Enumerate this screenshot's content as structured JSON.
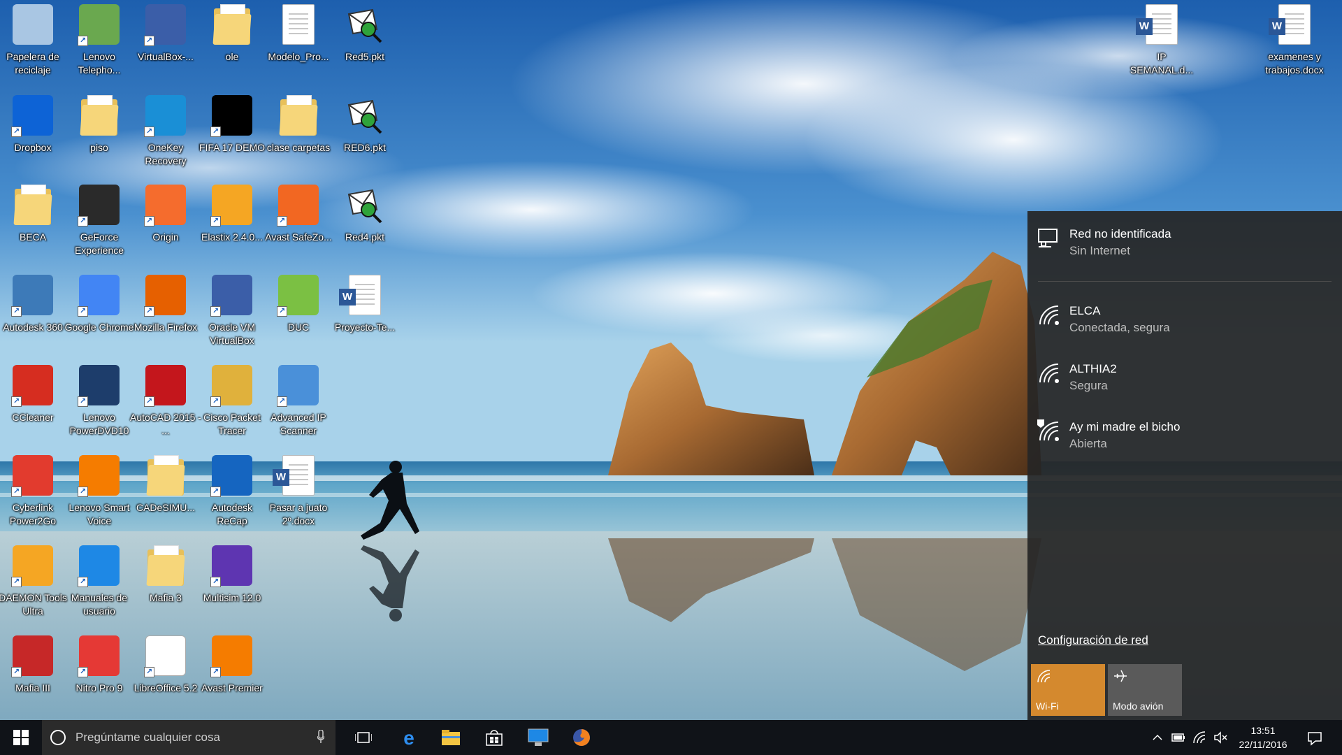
{
  "desktop": {
    "icons": [
      {
        "label": "Papelera de reciclaje",
        "icon": "recycle-bin-icon",
        "color": "#a9c6e3"
      },
      {
        "label": "Lenovo Telepho...",
        "icon": "lenovo-telephony-icon",
        "color": "#6aa84f"
      },
      {
        "label": "VirtualBox-...",
        "icon": "virtualbox-icon",
        "color": "#3b5ea8"
      },
      {
        "label": "ole",
        "icon": "folder-icon",
        "color": "#f6d67a"
      },
      {
        "label": "Modelo_Pro...",
        "icon": "document-icon",
        "color": "#ffffff"
      },
      {
        "label": "Red5.pkt",
        "icon": "packet-tracer-file-icon",
        "color": "#2fa33a"
      },
      {
        "label": "Dropbox",
        "icon": "dropbox-icon",
        "color": "#0d63d6"
      },
      {
        "label": "piso",
        "icon": "folder-icon",
        "color": "#f6d67a"
      },
      {
        "label": "OneKey Recovery",
        "icon": "onekey-recovery-icon",
        "color": "#1a8fd6"
      },
      {
        "label": "FIFA 17 DEMO",
        "icon": "fifa17-icon",
        "color": "#000000"
      },
      {
        "label": "clase carpetas",
        "icon": "folder-icon",
        "color": "#f6d67a"
      },
      {
        "label": "RED6.pkt",
        "icon": "packet-tracer-file-icon",
        "color": "#2fa33a"
      },
      {
        "label": "BECA",
        "icon": "folder-icon",
        "color": "#f6d67a"
      },
      {
        "label": "GeForce Experience",
        "icon": "geforce-icon",
        "color": "#2a2a2a"
      },
      {
        "label": "Origin",
        "icon": "origin-icon",
        "color": "#f56c2d"
      },
      {
        "label": "Elastix 2.4.0...",
        "icon": "elastix-icon",
        "color": "#f5a623"
      },
      {
        "label": "Avast SafeZo...",
        "icon": "avast-safezone-icon",
        "color": "#f26722"
      },
      {
        "label": "Red4.pkt",
        "icon": "packet-tracer-file-icon",
        "color": "#2fa33a"
      },
      {
        "label": "Autodesk 360",
        "icon": "autodesk360-icon",
        "color": "#3d7ab8"
      },
      {
        "label": "Google Chrome",
        "icon": "chrome-icon",
        "color": "#4285f4"
      },
      {
        "label": "Mozilla Firefox",
        "icon": "firefox-icon",
        "color": "#e66000"
      },
      {
        "label": "Oracle VM VirtualBox",
        "icon": "virtualbox-icon",
        "color": "#3b5ea8"
      },
      {
        "label": "DUC",
        "icon": "duc-icon",
        "color": "#7bc043"
      },
      {
        "label": "Proyecto-Te...",
        "icon": "word-document-icon",
        "color": "#2b5797"
      },
      {
        "label": "CCleaner",
        "icon": "ccleaner-icon",
        "color": "#d62d20"
      },
      {
        "label": "Lenovo PowerDVD10",
        "icon": "powerdvd-icon",
        "color": "#1d3d6b"
      },
      {
        "label": "AutoCAD 2015 - ...",
        "icon": "autocad-icon",
        "color": "#c4161c"
      },
      {
        "label": "Cisco Packet Tracer",
        "icon": "cisco-packet-tracer-icon",
        "color": "#e0b13c"
      },
      {
        "label": "Advanced IP Scanner",
        "icon": "advanced-ip-scanner-icon",
        "color": "#4a90d9"
      },
      {
        "label": "Cyberlink Power2Go",
        "icon": "power2go-icon",
        "color": "#e23b2e"
      },
      {
        "label": "Lenovo Smart Voice",
        "icon": "smart-voice-icon",
        "color": "#f57c00"
      },
      {
        "label": "CADeSIMU...",
        "icon": "folder-icon",
        "color": "#f6d67a"
      },
      {
        "label": "Autodesk ReCap",
        "icon": "autodesk-recap-icon",
        "color": "#1565c0"
      },
      {
        "label": "Pasar a juato 2º.docx",
        "icon": "word-document-icon",
        "color": "#2b5797"
      },
      {
        "label": "DAEMON Tools Ultra",
        "icon": "daemon-tools-icon",
        "color": "#f5a623"
      },
      {
        "label": "Manuales de usuario",
        "icon": "lenovo-manuals-icon",
        "color": "#1e88e5"
      },
      {
        "label": "Mafia 3",
        "icon": "folder-icon",
        "color": "#f6d67a"
      },
      {
        "label": "Multisim 12.0",
        "icon": "multisim-icon",
        "color": "#5e35b1"
      },
      {
        "label": "Mafia III",
        "icon": "mafia3-icon",
        "color": "#c62828"
      },
      {
        "label": "Nitro Pro 9",
        "icon": "nitro-pro-icon",
        "color": "#e53935"
      },
      {
        "label": "LibreOffice 5.2",
        "icon": "libreoffice-icon",
        "color": "#ffffff"
      },
      {
        "label": "Avast Premier",
        "icon": "avast-premier-icon",
        "color": "#f57c00"
      },
      {
        "label": "IP SEMANAL.d...",
        "icon": "word-document-icon",
        "color": "#2b5797"
      },
      {
        "label": "examenes y trabajos.docx",
        "icon": "word-document-icon",
        "color": "#2b5797"
      }
    ]
  },
  "flyout": {
    "networks": [
      {
        "name": "Red no identificada",
        "status": "Sin Internet",
        "icon": "wired-network-icon"
      },
      {
        "name": "ELCA",
        "status": "Conectada, segura",
        "icon": "wifi-icon"
      },
      {
        "name": "ALTHIA2",
        "status": "Segura",
        "icon": "wifi-icon"
      },
      {
        "name": "Ay mi madre el bicho",
        "status": "Abierta",
        "icon": "wifi-open-icon"
      }
    ],
    "settings_link": "Configuración de red",
    "tiles": [
      {
        "label": "Wi-Fi",
        "icon": "wifi-icon",
        "color": "#d4892e"
      },
      {
        "label": "Modo avión",
        "icon": "airplane-icon",
        "color": "#5a5a5a"
      }
    ]
  },
  "taskbar": {
    "search_placeholder": "Pregúntame cualquier cosa",
    "pinned": [
      "task-view-icon",
      "edge-icon",
      "file-explorer-icon",
      "store-icon",
      "lenovo-app-icon",
      "firefox-icon"
    ],
    "clock": {
      "time": "13:51",
      "date": "22/11/2016"
    }
  },
  "colors": {
    "accent": "#d4892e",
    "flyout_bg": "#262626",
    "taskbar_bg": "#101318"
  }
}
